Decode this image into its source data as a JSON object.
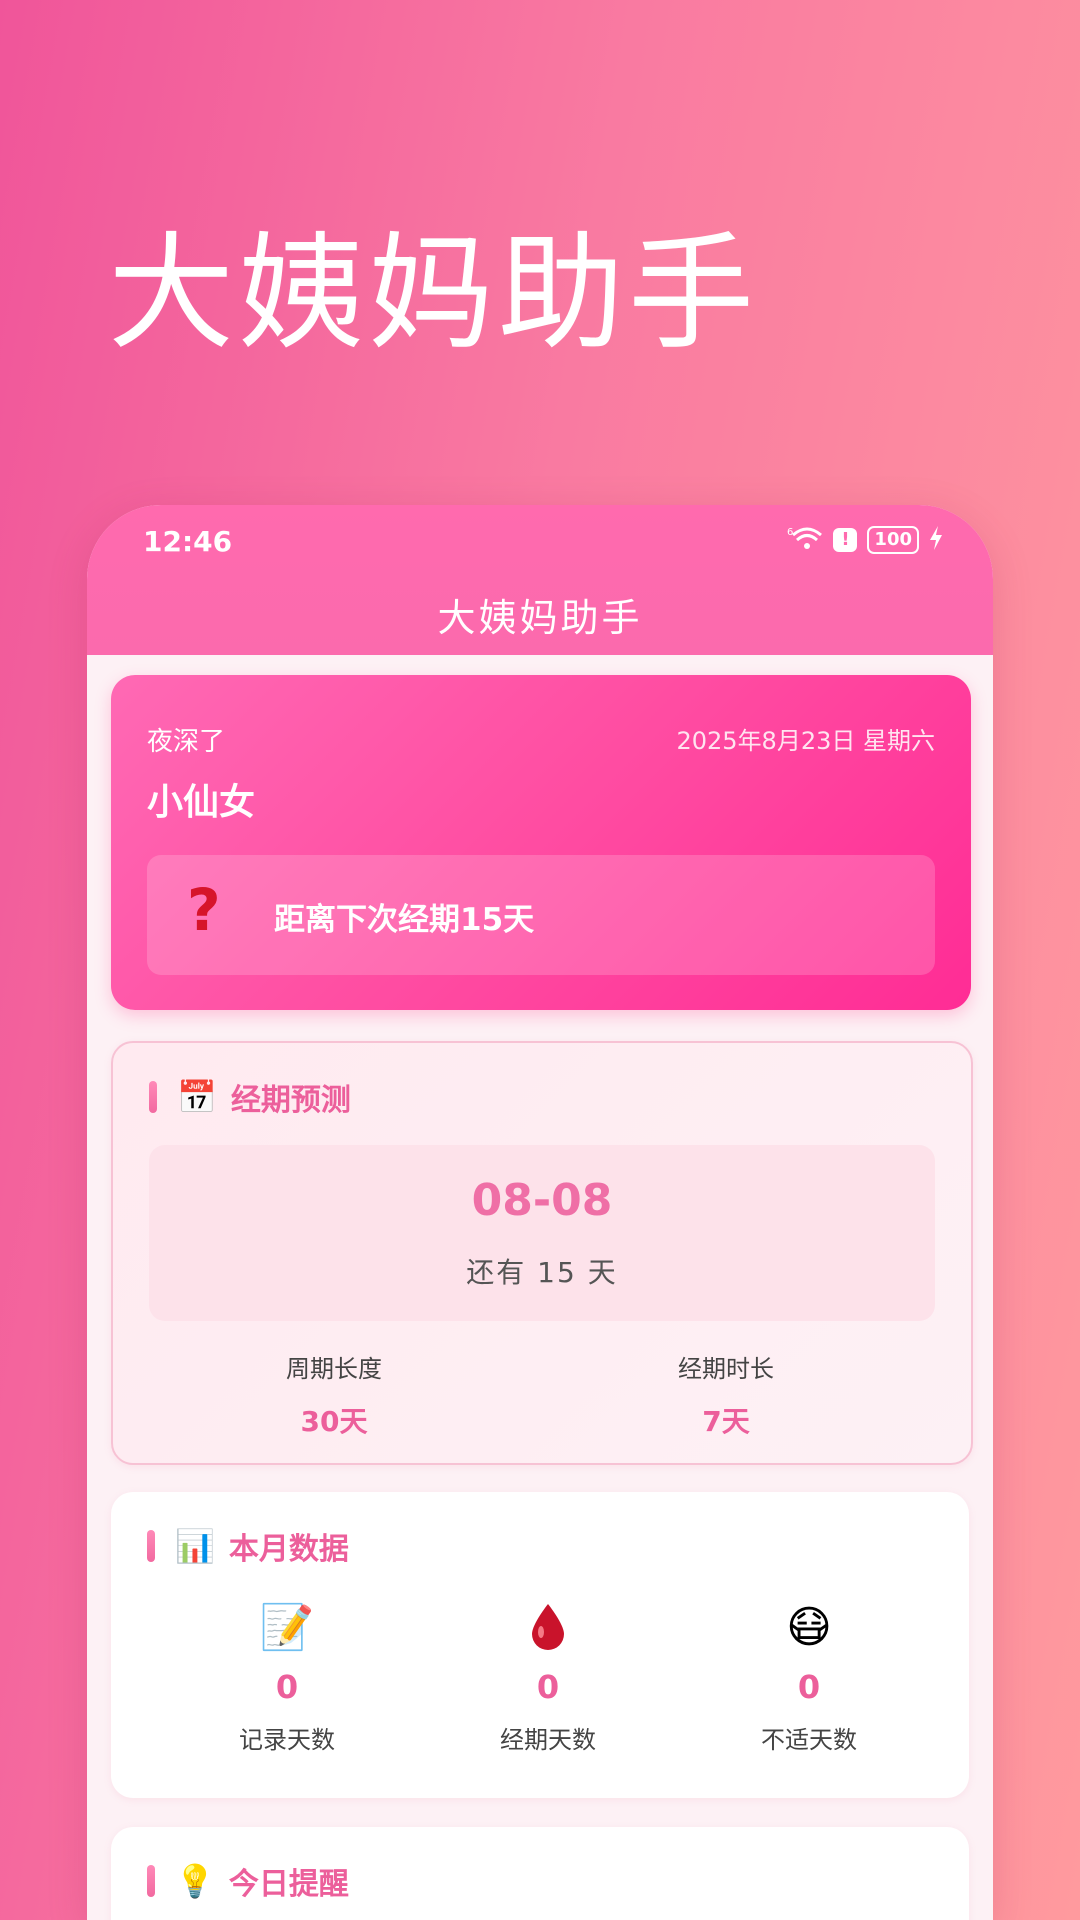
{
  "promo": {
    "title": "大姨妈助手"
  },
  "status_bar": {
    "time": "12:46",
    "signal": "6",
    "battery": "100"
  },
  "appbar": {
    "title": "大姨妈助手"
  },
  "hero": {
    "greeting": "夜深了",
    "date": "2025年8月23日 星期六",
    "username": "小仙女",
    "countdown": "距离下次经期15天",
    "icon": "question-mark-icon"
  },
  "prediction": {
    "title": "经期预测",
    "icon": "calendar-icon",
    "next_date": "08-08",
    "remaining": "还有 15 天",
    "cycle_label": "周期长度",
    "cycle_value": "30天",
    "duration_label": "经期时长",
    "duration_value": "7天"
  },
  "monthly": {
    "title": "本月数据",
    "icon": "bar-chart-icon",
    "stats": [
      {
        "icon": "memo-icon",
        "value": "0",
        "label": "记录天数"
      },
      {
        "icon": "blood-drop-icon",
        "value": "0",
        "label": "经期天数"
      },
      {
        "icon": "sick-face-icon",
        "value": "0",
        "label": "不适天数"
      }
    ]
  },
  "reminder": {
    "title": "今日提醒",
    "icon": "light-bulb-icon"
  },
  "colors": {
    "accent": "#ec5f9b",
    "appbar": "#ff6aae",
    "hero": "#ff4fa3"
  }
}
